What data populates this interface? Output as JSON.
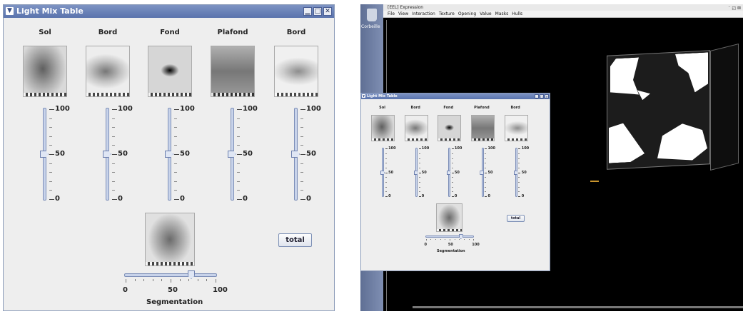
{
  "main_window": {
    "title": "Light Mix Table",
    "columns": [
      {
        "label": "Sol",
        "value": 50
      },
      {
        "label": "Bord",
        "value": 50
      },
      {
        "label": "Fond",
        "value": 50
      },
      {
        "label": "Plafond",
        "value": 50
      },
      {
        "label": "Bord",
        "value": 50
      }
    ],
    "slider_ticks": {
      "max": "100",
      "mid": "50",
      "min": "0"
    },
    "total_button": "total",
    "segmentation": {
      "label": "Segmentation",
      "tick_labels": [
        "0",
        "50",
        "100"
      ],
      "value": 73
    }
  },
  "desktop": {
    "trash_label": "Corbeille",
    "window_title": "[EEL] Expression",
    "menu": [
      "File",
      "View",
      "Interaction",
      "Texture",
      "Opening",
      "Value",
      "Masks",
      "Hulls"
    ],
    "title_buttons": "⁻ ◰ ⊠"
  }
}
